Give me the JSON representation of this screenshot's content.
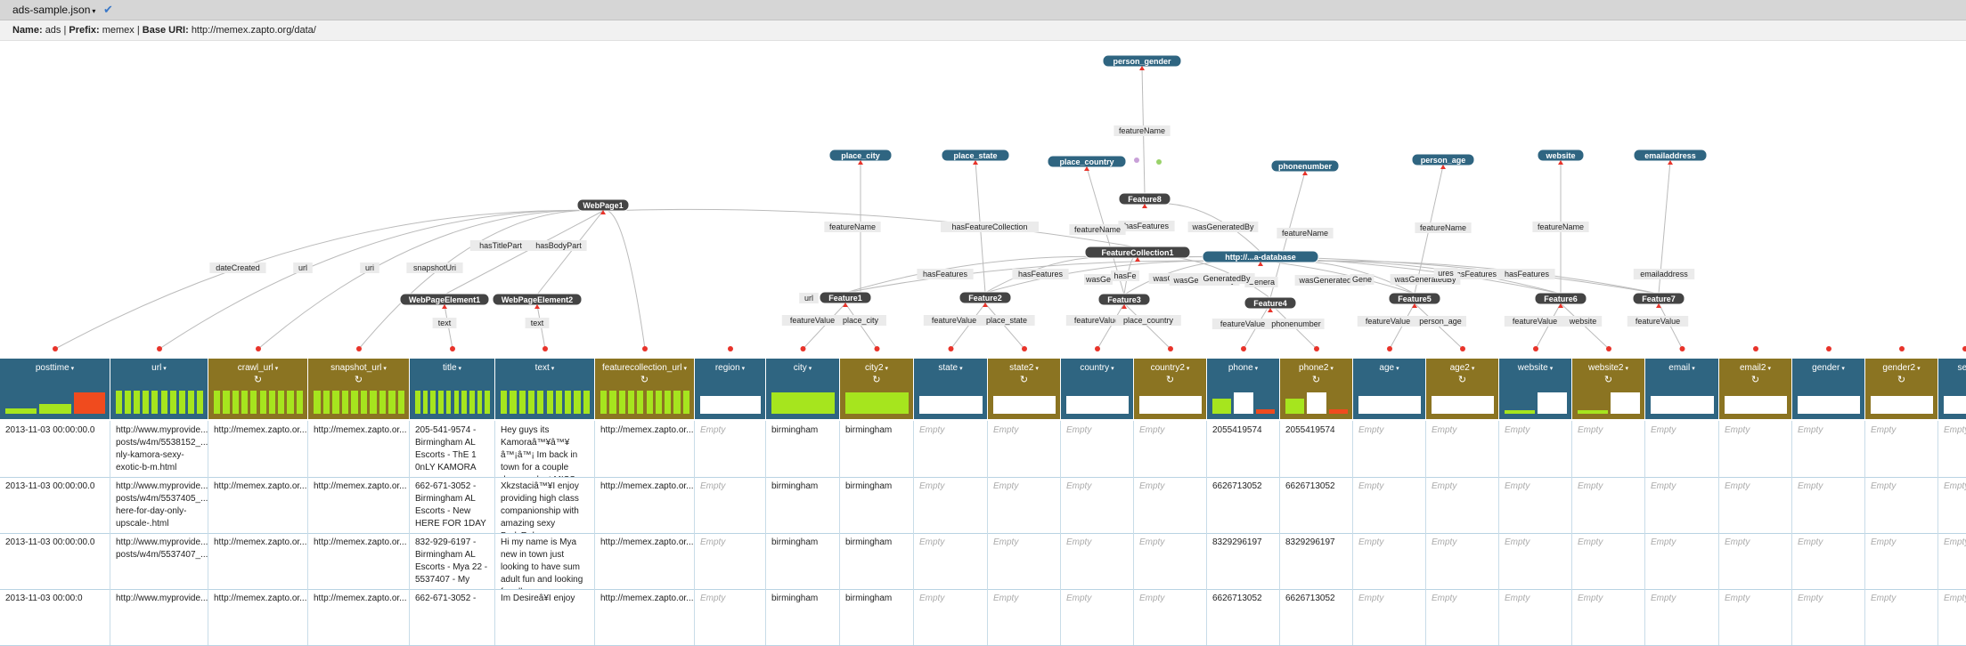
{
  "toolbar": {
    "source_label": "ads-sample.json",
    "caret": "▾",
    "status_icon": "check-icon",
    "status_glyph": "✔"
  },
  "model_info": {
    "name_label": "Name:",
    "name": "ads",
    "prefix_label": "Prefix:",
    "prefix": "memex",
    "base_label": "Base URI:",
    "base_uri": "http://memex.zapto.org/data/"
  },
  "colors": {
    "node": "#2f6581",
    "internal_node": "#444444",
    "link": "#bbbbbb",
    "pin": "#e8332a",
    "blue_header": "#2f6581",
    "olive_header": "#8b7422",
    "hist": "#a6e51e",
    "hist_alt": "#f04b1e"
  },
  "graph": {
    "nodes": [
      {
        "id": "person_gender",
        "label": "person_gender",
        "kind": "class"
      },
      {
        "id": "place_city",
        "label": "place_city",
        "kind": "class"
      },
      {
        "id": "place_state",
        "label": "place_state",
        "kind": "class"
      },
      {
        "id": "place_country",
        "label": "place_country",
        "kind": "class"
      },
      {
        "id": "phonenumber",
        "label": "phonenumber",
        "kind": "class"
      },
      {
        "id": "person_age",
        "label": "person_age",
        "kind": "class"
      },
      {
        "id": "website",
        "label": "website",
        "kind": "class"
      },
      {
        "id": "emailaddress",
        "label": "emailaddress",
        "kind": "class"
      },
      {
        "id": "Feature8",
        "label": "Feature8",
        "kind": "internal"
      },
      {
        "id": "WebPage1",
        "label": "WebPage1",
        "kind": "internal"
      },
      {
        "id": "FeatureCollection1",
        "label": "FeatureCollection1",
        "kind": "internal"
      },
      {
        "id": "database",
        "label": "http://...a-database",
        "kind": "class"
      },
      {
        "id": "WebPageElement1",
        "label": "WebPageElement1",
        "kind": "internal"
      },
      {
        "id": "WebPageElement2",
        "label": "WebPageElement2",
        "kind": "internal"
      },
      {
        "id": "Feature1",
        "label": "Feature1",
        "kind": "internal"
      },
      {
        "id": "Feature2",
        "label": "Feature2",
        "kind": "internal"
      },
      {
        "id": "Feature3",
        "label": "Feature3",
        "kind": "internal"
      },
      {
        "id": "Feature4",
        "label": "Feature4",
        "kind": "internal"
      },
      {
        "id": "Feature5",
        "label": "Feature5",
        "kind": "internal"
      },
      {
        "id": "Feature6",
        "label": "Feature6",
        "kind": "internal"
      },
      {
        "id": "Feature7",
        "label": "Feature7",
        "kind": "internal"
      }
    ],
    "edge_labels": [
      "featureName",
      "hasFeatures",
      "wasGeneratedBy",
      "featureName",
      "hasFeatureCollection",
      "featureName",
      "featureName",
      "featureName",
      "featureName",
      "dateCreated",
      "url",
      "uri",
      "snapshotUri",
      "hasTitlePart",
      "hasBodyPart",
      "text",
      "text",
      "url",
      "featureValue",
      "place_city",
      "featureValue",
      "place_state",
      "featureValue",
      "place_country",
      "featureValue",
      "phonenumber",
      "featureValue",
      "person_age",
      "featureValue",
      "website",
      "featureValue",
      "emailaddress",
      "hasFeatures",
      "hasFeatures",
      "hasFeatures",
      "wasGeneratedBy",
      "wasGeneratedBy",
      "Genera",
      "GeneratedBy",
      "wasGeneratedBy",
      "Gene",
      "wasGeneratedBy",
      "ures",
      "hasFeatures",
      "wasGe",
      "hasFe"
    ]
  },
  "columns": [
    {
      "label": "posttime",
      "style": "blue",
      "refresh": false,
      "hist": [
        0.25,
        0.45,
        1.0
      ]
    },
    {
      "label": "url",
      "style": "blue",
      "refresh": false,
      "hist": [
        1,
        1,
        1,
        1,
        1,
        1,
        1,
        1,
        1,
        1
      ]
    },
    {
      "label": "crawl_url",
      "style": "olive",
      "refresh": true,
      "hist": [
        1,
        1,
        1,
        1,
        1,
        1,
        1,
        1,
        1,
        1
      ]
    },
    {
      "label": "snapshot_url",
      "style": "olive",
      "refresh": true,
      "hist": [
        1,
        1,
        1,
        1,
        1,
        1,
        1,
        1,
        1,
        1
      ]
    },
    {
      "label": "title",
      "style": "blue",
      "refresh": false,
      "hist": [
        1,
        1,
        1,
        1,
        1,
        1,
        1,
        1,
        1,
        1
      ]
    },
    {
      "label": "text",
      "style": "blue",
      "refresh": false,
      "hist": [
        1,
        1,
        1,
        1,
        1,
        1,
        1,
        1,
        1,
        1
      ]
    },
    {
      "label": "featurecollection_url",
      "style": "olive",
      "refresh": true,
      "hist": [
        1,
        1,
        1,
        1,
        1,
        1,
        1,
        1,
        1,
        1
      ]
    },
    {
      "label": "region",
      "style": "blue",
      "refresh": false,
      "hist": []
    },
    {
      "label": "city",
      "style": "blue",
      "refresh": false,
      "hist": [
        1
      ]
    },
    {
      "label": "city2",
      "style": "olive",
      "refresh": true,
      "hist": [
        1
      ]
    },
    {
      "label": "state",
      "style": "blue",
      "refresh": false,
      "hist": []
    },
    {
      "label": "state2",
      "style": "olive",
      "refresh": true,
      "hist": []
    },
    {
      "label": "country",
      "style": "blue",
      "refresh": false,
      "hist": []
    },
    {
      "label": "country2",
      "style": "olive",
      "refresh": true,
      "hist": []
    },
    {
      "label": "phone",
      "style": "blue",
      "refresh": false,
      "hist": [
        0.7,
        1.0,
        0.2
      ]
    },
    {
      "label": "phone2",
      "style": "olive",
      "refresh": true,
      "hist": [
        0.7,
        1.0,
        0.2
      ]
    },
    {
      "label": "age",
      "style": "blue",
      "refresh": false,
      "hist": []
    },
    {
      "label": "age2",
      "style": "olive",
      "refresh": true,
      "hist": []
    },
    {
      "label": "website",
      "style": "blue",
      "refresh": false,
      "hist": [
        0.15,
        1.0
      ]
    },
    {
      "label": "website2",
      "style": "olive",
      "refresh": true,
      "hist": [
        0.15,
        1.0
      ]
    },
    {
      "label": "email",
      "style": "blue",
      "refresh": false,
      "hist": []
    },
    {
      "label": "email2",
      "style": "olive",
      "refresh": true,
      "hist": []
    },
    {
      "label": "gender",
      "style": "blue",
      "refresh": false,
      "hist": []
    },
    {
      "label": "gender2",
      "style": "olive",
      "refresh": true,
      "hist": []
    },
    {
      "label": "se",
      "style": "blue",
      "refresh": false,
      "hist": []
    }
  ],
  "empty_text": "Empty",
  "rows": [
    [
      "2013-11-03 00:00:00.0",
      "http://www.myprovide... posts/w4m/5538152_... nly-kamora-sexy-exotic-b-m.html",
      "http://memex.zapto.or...",
      "http://memex.zapto.or...",
      "205-541-9574 - Birmingham AL Escorts - ThE 1 0nLY KAMORA",
      "Hey guys its Kamoraâ™¥â™¥ â™¡â™¡ Im back in town for a couple days so dont MISS",
      "http://memex.zapto.or...",
      "",
      "birmingham",
      "birmingham",
      "",
      "",
      "",
      "",
      "2055419574",
      "2055419574",
      "",
      "",
      "",
      "",
      "",
      "",
      "",
      "",
      ""
    ],
    [
      "2013-11-03 00:00:00.0",
      "http://www.myprovide... posts/w4m/5537405_... here-for-day-only-upscale-.html",
      "http://memex.zapto.or...",
      "http://memex.zapto.or...",
      "662-671-3052 - Birmingham AL Escorts - New HERE FOR 1DAY",
      "Xkzstaciâ™¥I enjoy providing high class companionship with amazing sexy BodyRub",
      "http://memex.zapto.or...",
      "",
      "birmingham",
      "birmingham",
      "",
      "",
      "",
      "",
      "6626713052",
      "6626713052",
      "",
      "",
      "",
      "",
      "",
      "",
      "",
      "",
      ""
    ],
    [
      "2013-11-03 00:00:00.0",
      "http://www.myprovide... posts/w4m/5537407_...",
      "http://memex.zapto.or...",
      "http://memex.zapto.or...",
      "832-929-6197 - Birmingham AL Escorts - Mya 22 - 5537407 - My",
      "Hi my name is Mya new in town just looking to have sum adult fun and looking for all sexy guys",
      "http://memex.zapto.or...",
      "",
      "birmingham",
      "birmingham",
      "",
      "",
      "",
      "",
      "8329296197",
      "8329296197",
      "",
      "",
      "",
      "",
      "",
      "",
      "",
      "",
      ""
    ],
    [
      "2013-11-03 00:00:0",
      "http://www.myprovide...",
      "http://memex.zapto.or...",
      "http://memex.zapto.or...",
      "662-671-3052 -",
      "Im Desireâ¥I enjoy",
      "http://memex.zapto.or...",
      "",
      "birmingham",
      "birmingham",
      "",
      "",
      "",
      "",
      "6626713052",
      "6626713052",
      "",
      "",
      "",
      "",
      "",
      "",
      "",
      "",
      ""
    ]
  ]
}
